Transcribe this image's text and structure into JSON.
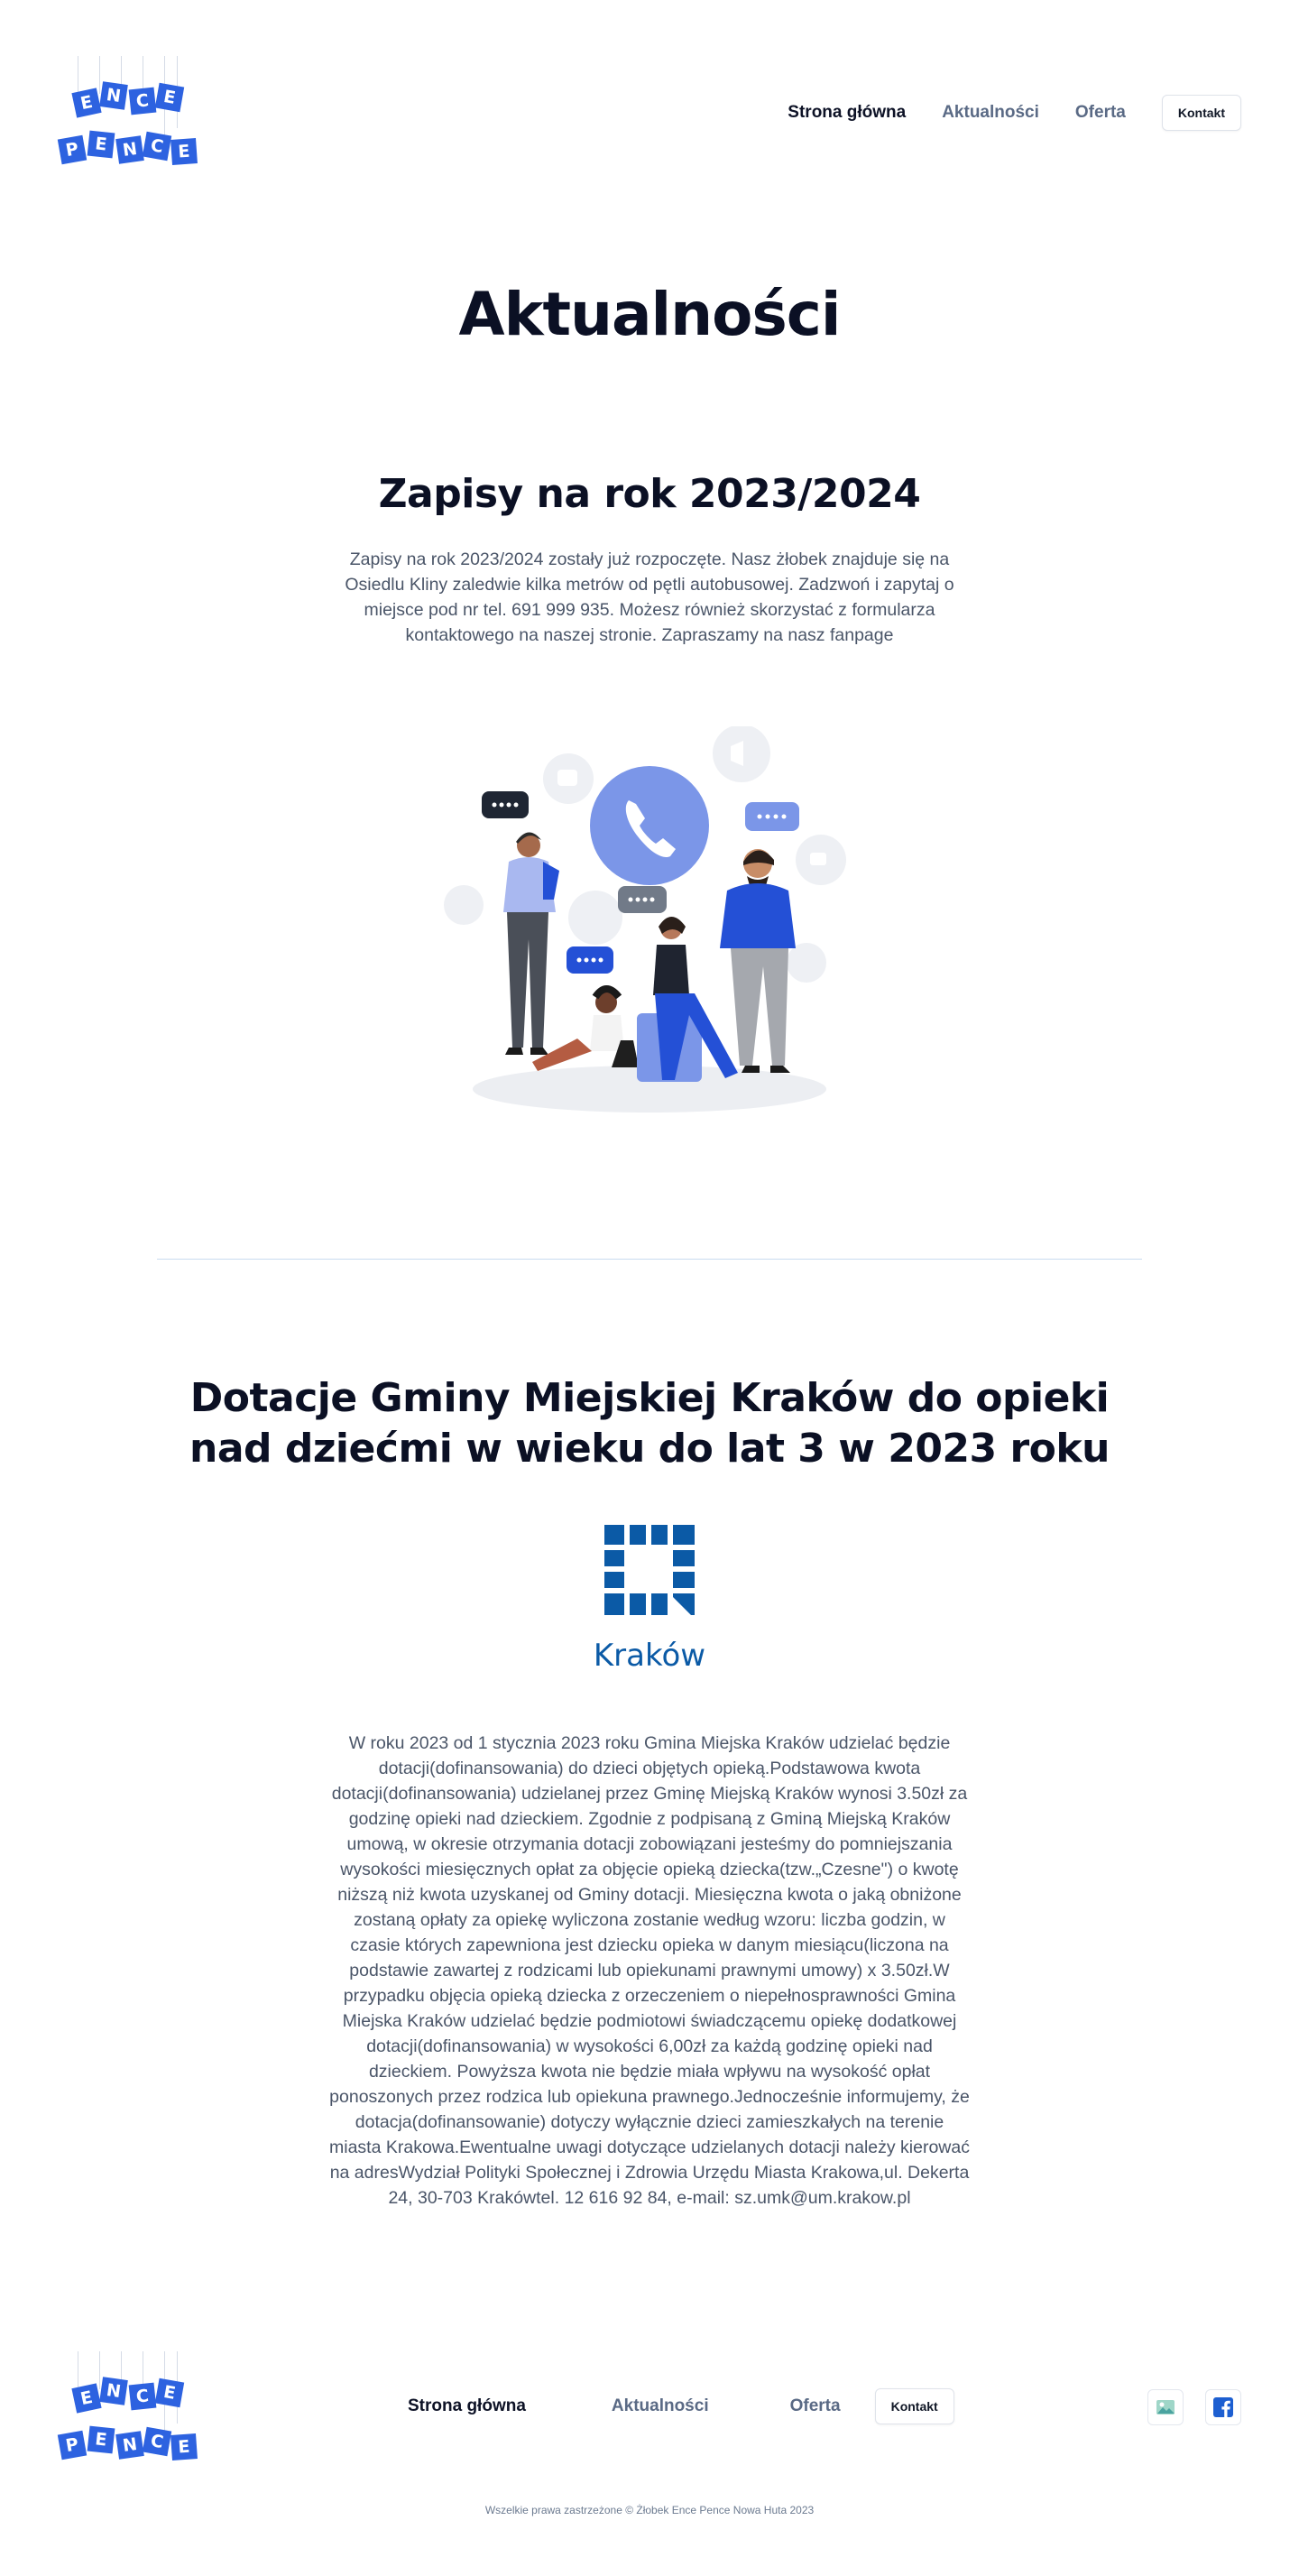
{
  "header": {
    "logo": {
      "word1": [
        "E",
        "N",
        "C",
        "E"
      ],
      "word2": [
        "P",
        "E",
        "N",
        "C",
        "E"
      ]
    },
    "nav": [
      "Strona główna",
      "Aktualności",
      "Oferta"
    ],
    "contact_label": "Kontakt"
  },
  "main": {
    "page_title": "Aktualności",
    "posts": [
      {
        "title": "Zapisy na rok 2023/2024",
        "body": "Zapisy na rok 2023/2024 zostały już rozpoczęte. Nasz żłobek znajduje się na Osiedlu Kliny zaledwie kilka metrów od pętli autobusowej. Zadzwoń i zapytaj o miejsce pod nr tel. 691 999 935. Możesz również skorzystać z formularza kontaktowego na naszej stronie. Zapraszamy na nasz fanpage",
        "image": "people-on-phone-illustration"
      },
      {
        "title": "Dotacje Gminy Miejskiej Kraków do opieki nad dziećmi w wieku do lat 3 w 2023 roku",
        "logo_text": "Kraków",
        "body": "W roku 2023 od 1 stycznia 2023 roku Gmina Miejska Kraków udzielać będzie dotacji(dofinansowania) do dzieci objętych opieką.Podstawowa kwota dotacji(dofinansowania) udzielanej przez Gminę Miejską Kraków wynosi 3.50zł za godzinę opieki nad dzieckiem. Zgodnie z podpisaną z Gminą Miejską Kraków umową, w okresie otrzymania dotacji zobowiązani jesteśmy do pomniejszania wysokości miesięcznych opłat za objęcie opieką dziecka(tzw.„Czesne\") o kwotę niższą niż kwota uzyskanej od Gminy dotacji. Miesięczna kwota o jaką obniżone zostaną opłaty za opiekę wyliczona zostanie według wzoru: liczba godzin, w czasie których zapewniona jest dziecku opieka w danym miesiącu(liczona na podstawie zawartej z rodzicami lub opiekunami prawnymi umowy) x 3.50zł.W przypadku objęcia opieką dziecka z orzeczeniem o niepełnosprawności Gmina Miejska Kraków udzielać będzie podmiotowi świadczącemu opiekę dodatkowej dotacji(dofinansowania) w wysokości 6,00zł za każdą godzinę opieki nad dzieckiem. Powyższa kwota nie będzie miała wpływu na wysokość opłat ponoszonych przez rodzica lub opiekuna prawnego.Jednocześnie informujemy, że dotacja(dofinansowanie) dotyczy wyłącznie dzieci zamieszkałych na terenie miasta Krakowa.Ewentualne uwagi dotyczące udzielanych dotacji należy kierować na adresWydział Polityki Społecznej i Zdrowia Urzędu Miasta Krakowa,ul. Dekerta 24, 30-703 Krakówtel. 12 616 92 84, e-mail: sz.umk@um.krakow.pl"
      }
    ]
  },
  "footer": {
    "nav": [
      "Strona główna",
      "Aktualności",
      "Oferta"
    ],
    "contact_label": "Kontakt",
    "social_icons": [
      "image-icon",
      "facebook-icon"
    ],
    "copyright": "Wszelkie prawa zastrzeżone © Żłobek Ence Pence Nowa Huta 2023"
  },
  "colors": {
    "brand_blue": "#2d62e0",
    "heading": "#0b1024",
    "nav_inactive": "#5a6a85",
    "krakow_blue": "#0b5aa6",
    "divider": "#c9dcef"
  }
}
